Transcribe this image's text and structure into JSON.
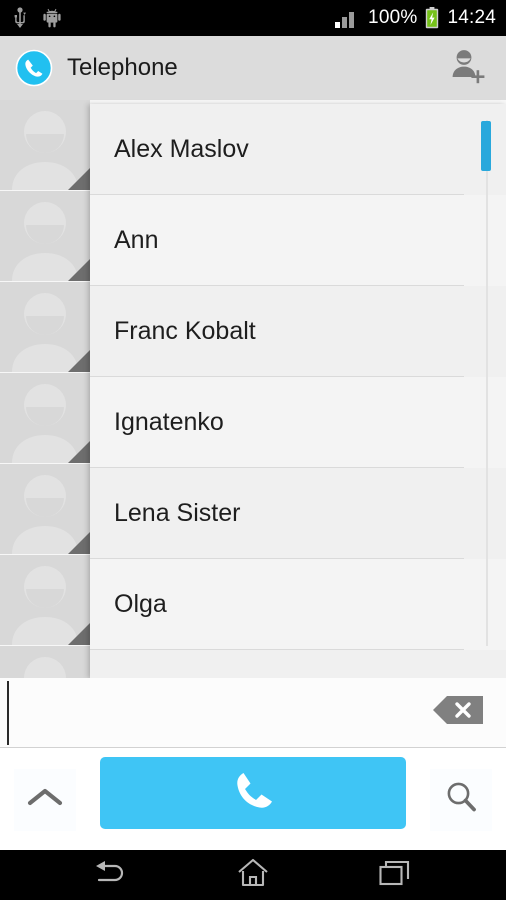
{
  "status_bar": {
    "usb_icon": "usb-icon",
    "android_icon": "android-debug-icon",
    "signal_icon": "signal-bars-icon",
    "battery_percent": "100%",
    "battery_icon": "battery-charging-icon",
    "clock": "14:24"
  },
  "header": {
    "app_icon": "phone-circle-icon",
    "title": "Telephone",
    "add_contact_icon": "add-contact-icon",
    "background": "#dcdcdc"
  },
  "contacts_backdrop": {
    "avatar_icon": "default-avatar-icon",
    "rows": [
      {
        "avatar": "default-avatar-icon"
      },
      {
        "avatar": "default-avatar-icon"
      },
      {
        "avatar": "default-avatar-icon"
      },
      {
        "avatar": "default-avatar-icon"
      },
      {
        "avatar": "default-avatar-icon"
      },
      {
        "avatar": "default-avatar-icon"
      },
      {
        "avatar": "default-avatar-icon"
      }
    ]
  },
  "dropdown": {
    "accent_color": "#29a8dc",
    "items": [
      {
        "name": "Alex Maslov"
      },
      {
        "name": "Ann"
      },
      {
        "name": "Franc Kobalt"
      },
      {
        "name": "Ignatenko"
      },
      {
        "name": "Lena Sister"
      },
      {
        "name": "Olga"
      },
      {
        "name": ""
      }
    ]
  },
  "dial_input": {
    "value": "",
    "placeholder": "",
    "backspace_icon": "backspace-delete-icon"
  },
  "action_bar": {
    "expand_icon": "chevron-up-icon",
    "call_icon": "phone-handset-icon",
    "call_button_color": "#3fc5f5",
    "search_icon": "search-icon"
  },
  "nav_bar": {
    "back_icon": "back-arrow-icon",
    "home_icon": "home-icon",
    "recents_icon": "recent-apps-icon"
  }
}
